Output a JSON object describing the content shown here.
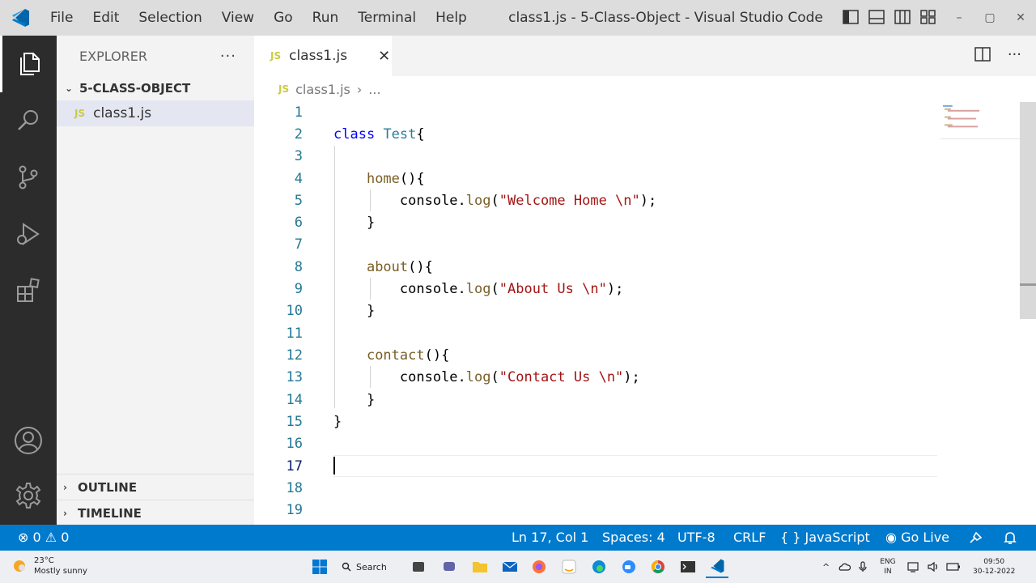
{
  "titlebar": {
    "menu": [
      "File",
      "Edit",
      "Selection",
      "View",
      "Go",
      "Run",
      "Terminal",
      "Help"
    ],
    "window_title": "class1.js - 5-Class-Object - Visual Studio Code",
    "controls": {
      "minimize": "–",
      "maximize": "▢",
      "close": "✕"
    }
  },
  "sidebar": {
    "title": "EXPLORER",
    "more": "···",
    "folder": "5-CLASS-OBJECT",
    "files": [
      {
        "badge": "JS",
        "name": "class1.js"
      }
    ],
    "outline": "OUTLINE",
    "timeline": "TIMELINE"
  },
  "editor": {
    "tab": {
      "badge": "JS",
      "label": "class1.js",
      "close": "✕"
    },
    "more_actions": "···",
    "breadcrumb": {
      "badge": "JS",
      "file": "class1.js",
      "separator": "›",
      "rest": "..."
    },
    "line_numbers": [
      "1",
      "2",
      "3",
      "4",
      "5",
      "6",
      "7",
      "8",
      "9",
      "10",
      "11",
      "12",
      "13",
      "14",
      "15",
      "16",
      "17",
      "18",
      "19"
    ],
    "code": {
      "l2_kw": "class",
      "l2_cls": "Test",
      "l2_brace": "{",
      "home_fn": "home",
      "about_fn": "about",
      "contact_fn": "contact",
      "paren_brace": "(){",
      "console": "console",
      "dot": ".",
      "log": "log",
      "open": "(",
      "close_stmt": ");",
      "str_home": "\"Welcome Home \\n\"",
      "str_about": "\"About Us \\n\"",
      "str_contact": "\"Contact Us \\n\"",
      "close_brace": "}"
    }
  },
  "statusbar": {
    "errors": "0",
    "warnings": "0",
    "position": "Ln 17, Col 1",
    "spaces": "Spaces: 4",
    "encoding": "UTF-8",
    "eol": "CRLF",
    "lang_icon": "{ }",
    "language": "JavaScript",
    "golive": "Go Live"
  },
  "taskbar": {
    "temperature": "23°C",
    "weather": "Mostly sunny",
    "search": "Search",
    "lang_top": "ENG",
    "lang_bottom": "IN",
    "time": "09:50",
    "date": "30-12-2022"
  },
  "colors": {
    "accent": "#007acc",
    "activitybar": "#2c2c2c",
    "keyword": "#0000ff",
    "class": "#267f99",
    "function": "#795e26",
    "string": "#a31515",
    "line_number": "#237893"
  }
}
